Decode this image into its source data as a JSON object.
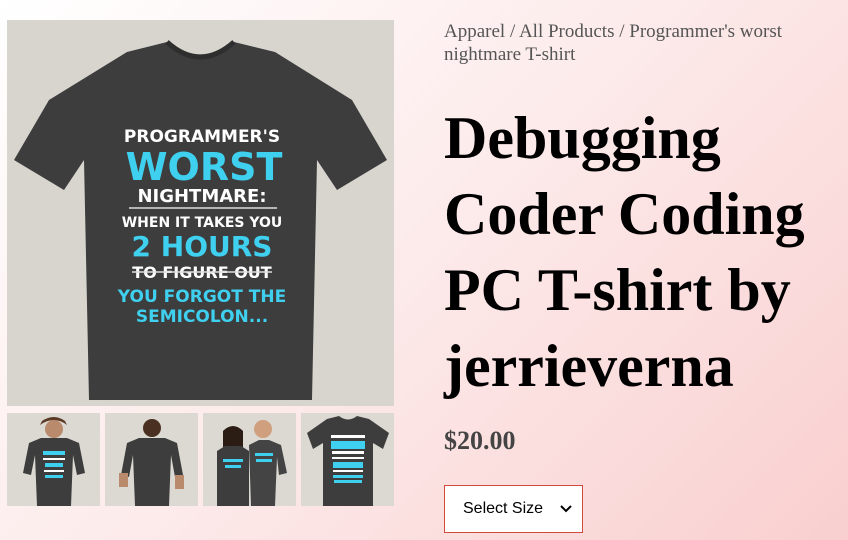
{
  "breadcrumb": {
    "items": [
      "Apparel",
      "All Products",
      "Programmer's worst nightmare T-shirt"
    ],
    "separator": "/"
  },
  "product": {
    "title": "Debugging Coder Coding PC T-shirt by jerrieverna",
    "price": "$20.00",
    "size_select": {
      "selected": "Select Size"
    }
  },
  "shirt_print": {
    "line1": "PROGRAMMER'S",
    "line2": "WORST",
    "line3": "NIGHTMARE:",
    "line4": "WHEN IT TAKES YOU",
    "line5": "2 HOURS",
    "line6": "TO FIGURE OUT",
    "line7": "YOU FORGOT THE",
    "line8": "SEMICOLON..."
  },
  "colors": {
    "shirt": "#3d3d3d",
    "cyan": "#3fd0f0",
    "white": "#ffffff",
    "select_border": "#d04b3a"
  }
}
